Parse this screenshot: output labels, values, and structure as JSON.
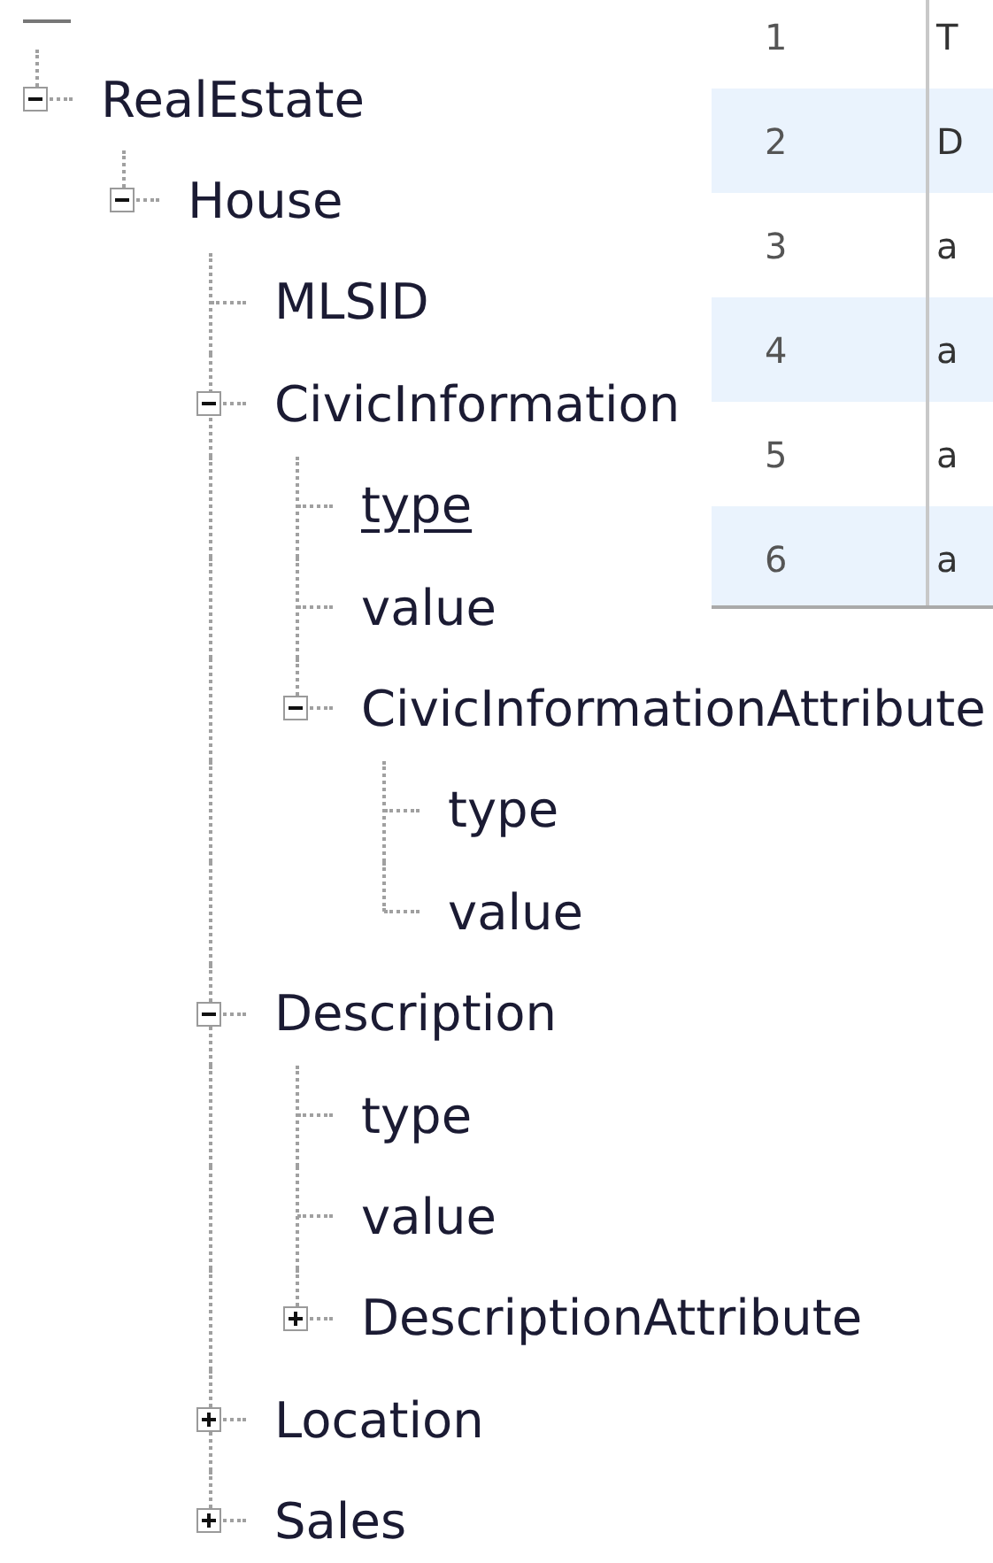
{
  "tree": [
    {
      "label": "RealEstate",
      "kind": "node",
      "expanded": true,
      "hovered": false,
      "children": [
        {
          "label": "House",
          "kind": "node",
          "expanded": true,
          "hovered": false,
          "children": [
            {
              "label": "MLSID",
              "kind": "leaf",
              "hovered": false
            },
            {
              "label": "CivicInformation",
              "kind": "node",
              "expanded": true,
              "hovered": false,
              "children": [
                {
                  "label": "type",
                  "kind": "leaf",
                  "hovered": true
                },
                {
                  "label": "value",
                  "kind": "leaf",
                  "hovered": false
                },
                {
                  "label": "CivicInformationAttribute",
                  "kind": "node",
                  "expanded": true,
                  "hovered": false,
                  "children": [
                    {
                      "label": "type",
                      "kind": "leaf",
                      "hovered": false
                    },
                    {
                      "label": "value",
                      "kind": "leaf",
                      "hovered": false
                    }
                  ]
                }
              ]
            },
            {
              "label": "Description",
              "kind": "node",
              "expanded": true,
              "hovered": false,
              "children": [
                {
                  "label": "type",
                  "kind": "leaf",
                  "hovered": false
                },
                {
                  "label": "value",
                  "kind": "leaf",
                  "hovered": false
                },
                {
                  "label": "DescriptionAttribute",
                  "kind": "node",
                  "expanded": false,
                  "hovered": false
                }
              ]
            },
            {
              "label": "Location",
              "kind": "node",
              "expanded": false,
              "hovered": false
            },
            {
              "label": "Sales",
              "kind": "node",
              "expanded": false,
              "hovered": false
            }
          ]
        }
      ]
    }
  ],
  "table": {
    "rows": [
      {
        "number": "1",
        "cell": "T"
      },
      {
        "number": "2",
        "cell": "D"
      },
      {
        "number": "3",
        "cell": "a"
      },
      {
        "number": "4",
        "cell": "a"
      },
      {
        "number": "5",
        "cell": "a"
      },
      {
        "number": "6",
        "cell": "a"
      }
    ]
  }
}
